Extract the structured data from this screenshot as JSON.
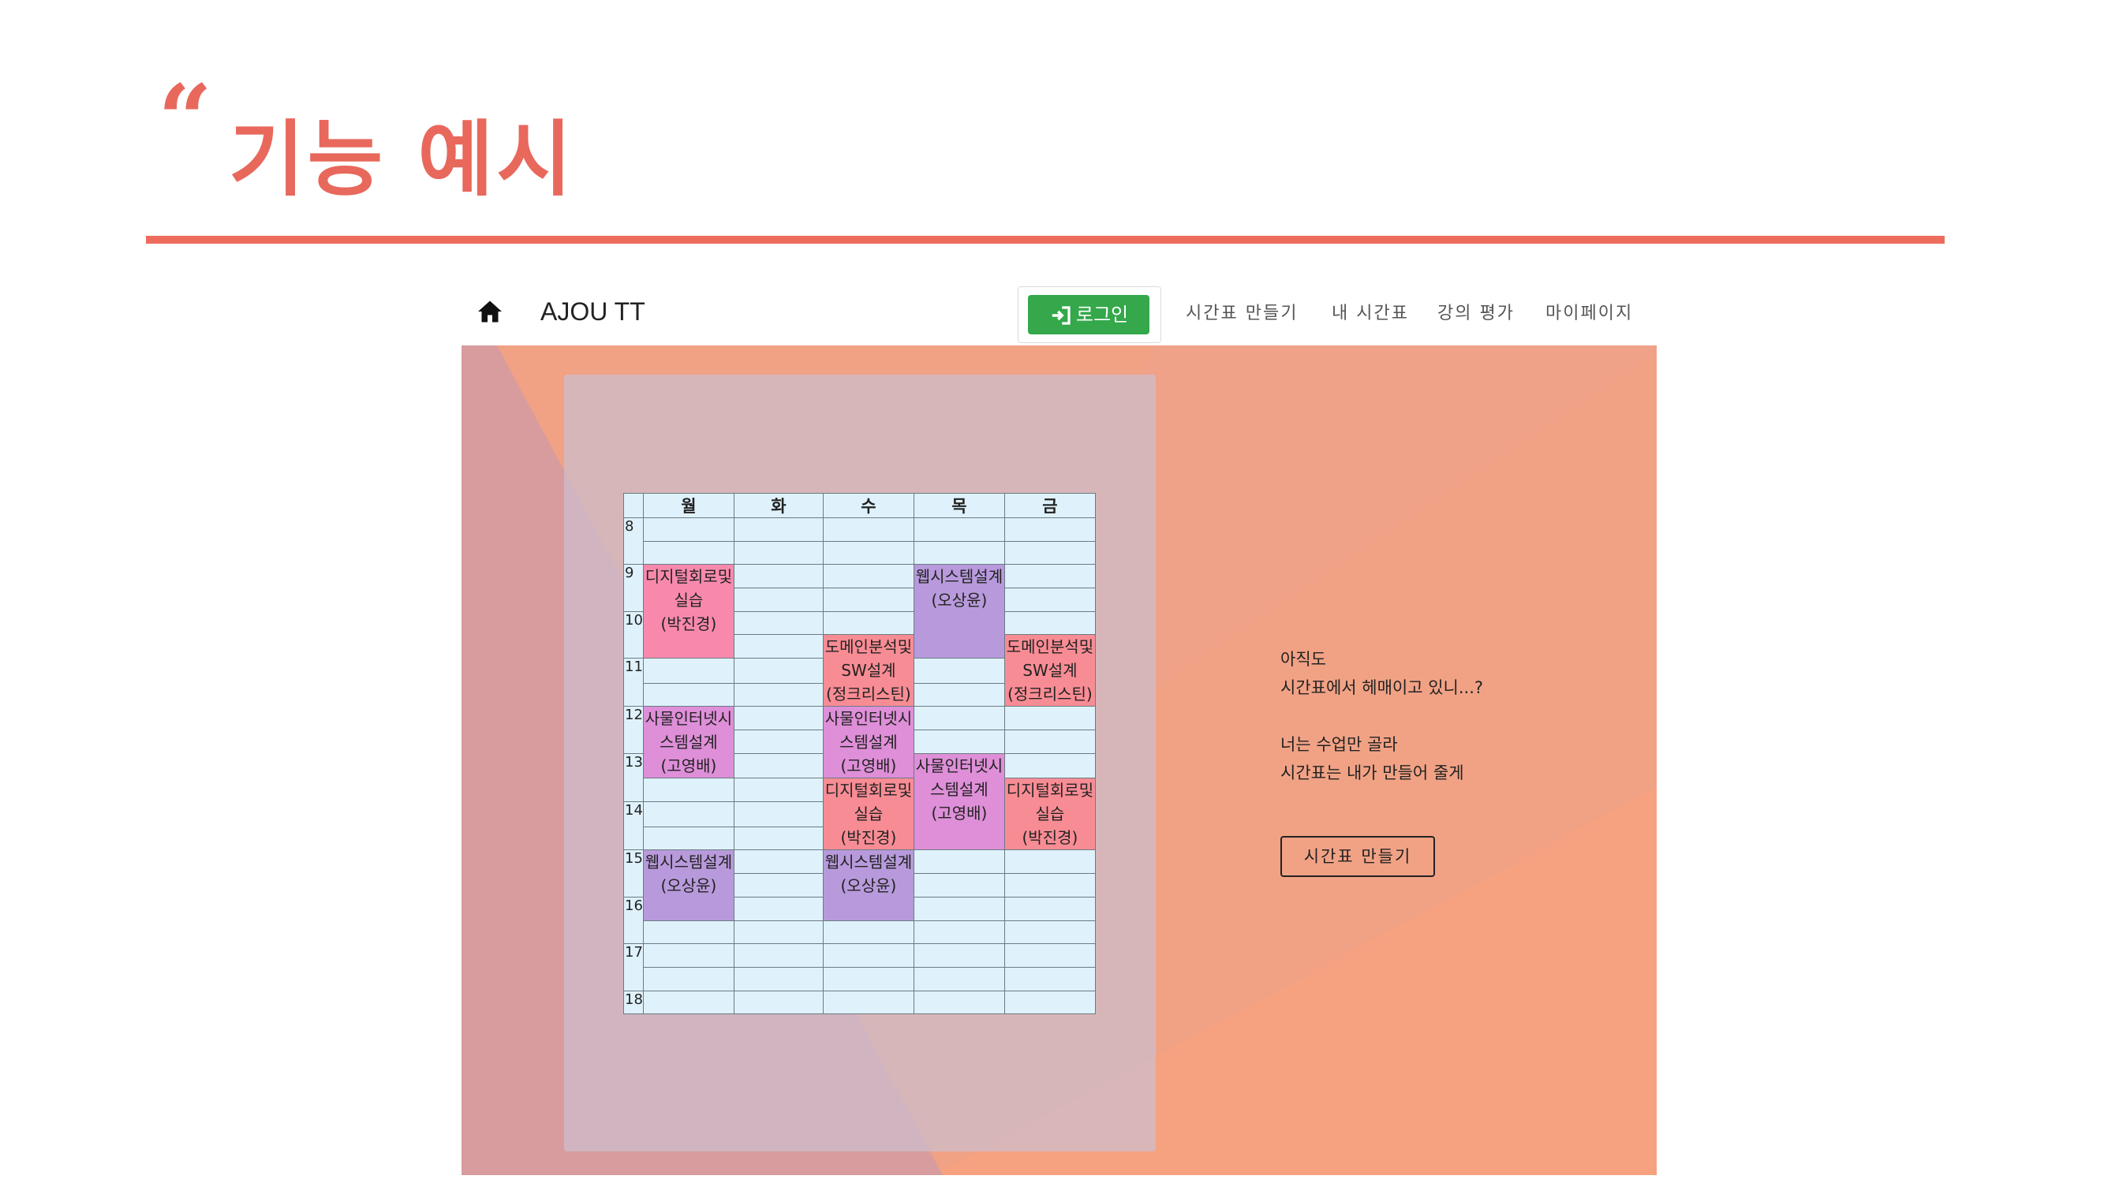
{
  "slide": {
    "quote_mark": "“",
    "title": "기능 예시",
    "accent_color": "#e8685c"
  },
  "navbar": {
    "home_icon": "home-icon",
    "brand": "AJOU TT",
    "login_label": "로그인",
    "links": [
      "시간표 만들기",
      "내 시간표",
      "강의 평가",
      "마이페이지"
    ]
  },
  "timetable": {
    "days": [
      "월",
      "화",
      "수",
      "목",
      "금"
    ],
    "hours": [
      "8",
      "9",
      "10",
      "11",
      "12",
      "13",
      "14",
      "15",
      "16",
      "17",
      "18"
    ],
    "courses": [
      {
        "day": "월",
        "lines": [
          "디지털회로및",
          "실습",
          "(박진경)"
        ]
      },
      {
        "day": "목",
        "lines": [
          "웹시스템설계",
          "(오상윤)"
        ]
      },
      {
        "day": "수",
        "lines": [
          "도메인분석및",
          "SW설계",
          "(정크리스틴)"
        ]
      },
      {
        "day": "금",
        "lines": [
          "도메인분석및",
          "SW설계",
          "(정크리스틴)"
        ]
      },
      {
        "day": "월",
        "lines": [
          "사물인터넷시",
          "스템설계",
          "(고영배)"
        ]
      },
      {
        "day": "수",
        "lines": [
          "사물인터넷시",
          "스템설계",
          "(고영배)"
        ]
      },
      {
        "day": "목",
        "lines": [
          "사물인터넷시",
          "스템설계",
          "(고영배)"
        ]
      },
      {
        "day": "수",
        "lines": [
          "디지털회로및",
          "실습",
          "(박진경)"
        ]
      },
      {
        "day": "금",
        "lines": [
          "디지털회로및",
          "실습",
          "(박진경)"
        ]
      },
      {
        "day": "월",
        "lines": [
          "웹시스템설계",
          "(오상윤)"
        ]
      },
      {
        "day": "수",
        "lines": [
          "웹시스템설계",
          "(오상윤)"
        ]
      }
    ]
  },
  "hero": {
    "line1": "아직도",
    "line2": "시간표에서 헤매이고 있니...?",
    "line3": "너는 수업만 골라",
    "line4": "시간표는 내가 만들어 줄게",
    "cta_label": "시간표 만들기"
  }
}
